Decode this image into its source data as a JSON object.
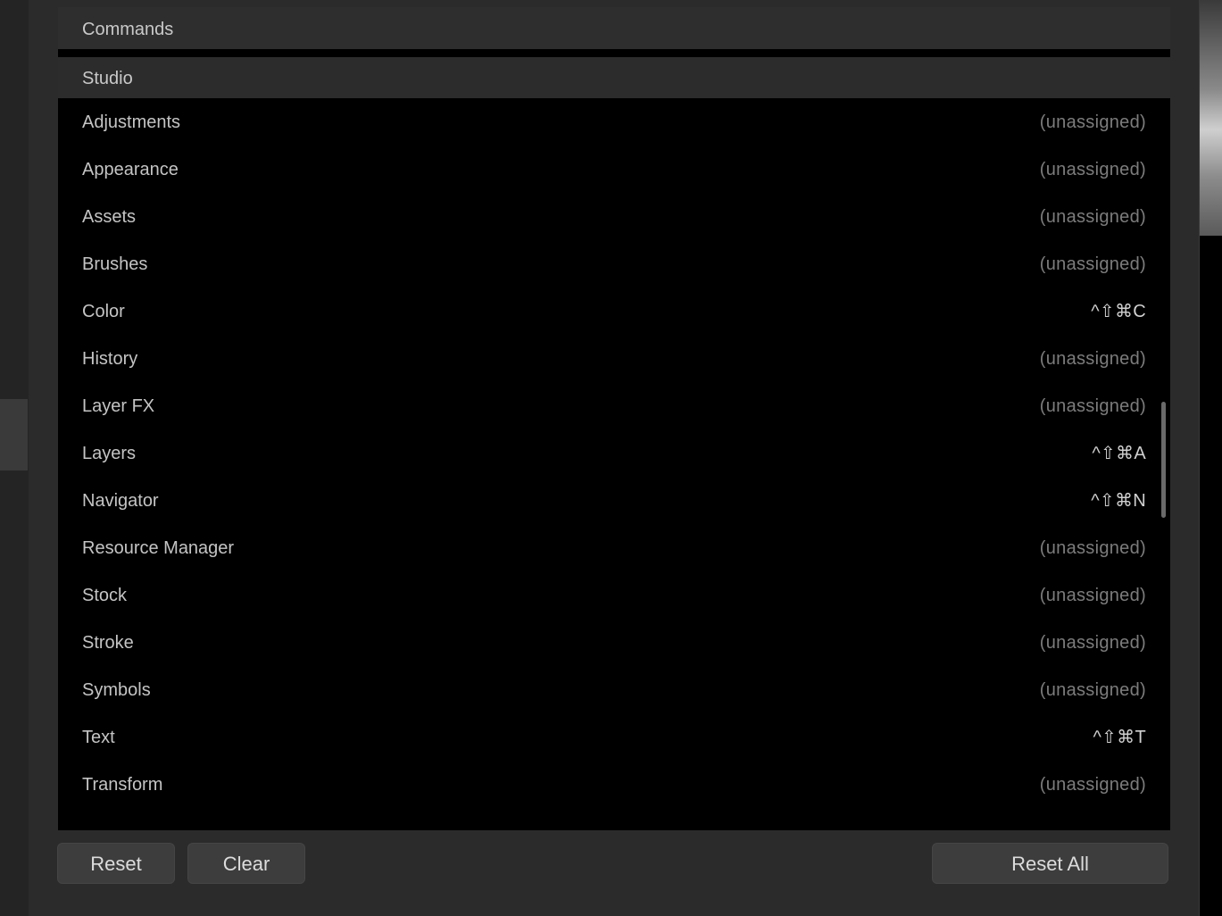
{
  "commands_header": "Commands",
  "group": {
    "title": "Studio",
    "items": [
      {
        "name": "Adjustments",
        "shortcut": "(unassigned)",
        "assigned": false
      },
      {
        "name": "Appearance",
        "shortcut": "(unassigned)",
        "assigned": false
      },
      {
        "name": "Assets",
        "shortcut": "(unassigned)",
        "assigned": false
      },
      {
        "name": "Brushes",
        "shortcut": "(unassigned)",
        "assigned": false
      },
      {
        "name": "Color",
        "shortcut": "^⇧⌘C",
        "assigned": true
      },
      {
        "name": "History",
        "shortcut": "(unassigned)",
        "assigned": false
      },
      {
        "name": "Layer FX",
        "shortcut": "(unassigned)",
        "assigned": false
      },
      {
        "name": "Layers",
        "shortcut": "^⇧⌘A",
        "assigned": true
      },
      {
        "name": "Navigator",
        "shortcut": "^⇧⌘N",
        "assigned": true
      },
      {
        "name": "Resource Manager",
        "shortcut": "(unassigned)",
        "assigned": false
      },
      {
        "name": "Stock",
        "shortcut": "(unassigned)",
        "assigned": false
      },
      {
        "name": "Stroke",
        "shortcut": "(unassigned)",
        "assigned": false
      },
      {
        "name": "Symbols",
        "shortcut": "(unassigned)",
        "assigned": false
      },
      {
        "name": "Text",
        "shortcut": "^⇧⌘T",
        "assigned": true
      },
      {
        "name": "Transform",
        "shortcut": "(unassigned)",
        "assigned": false
      }
    ]
  },
  "buttons": {
    "reset": "Reset",
    "clear": "Clear",
    "reset_all": "Reset All"
  }
}
